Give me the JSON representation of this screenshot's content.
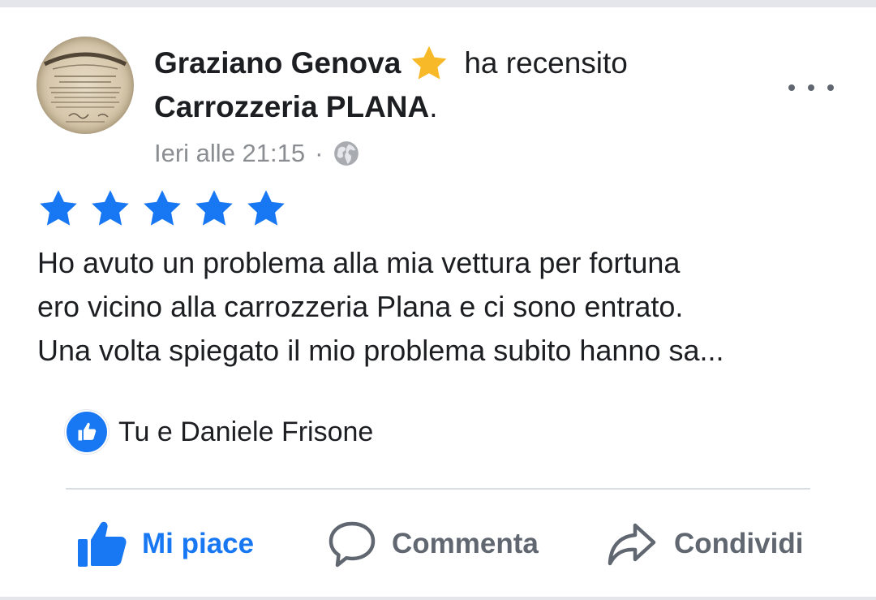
{
  "colors": {
    "facebook_blue": "#1877f2",
    "badge_gold": "#f7b928",
    "text_primary": "#1c1e21",
    "text_secondary": "#8a8d91",
    "icon_gray": "#606770"
  },
  "post": {
    "author": "Graziano Genova",
    "author_badge_icon": "star-icon",
    "action_text": "ha recensito",
    "page_name": "Carrozzeria PLANA",
    "page_suffix": ".",
    "timestamp": "Ieri alle 21:15",
    "meta_separator": "·",
    "privacy_icon": "globe-icon",
    "more_icon": "more-options-icon"
  },
  "review": {
    "rating": 5,
    "rating_max": 5,
    "text_lines": [
      "Ho avuto un problema alla mia vettura per fortuna",
      "ero vicino alla carrozzeria Plana e ci sono entrato.",
      "Una volta spiegato il mio problema subito hanno sa..."
    ]
  },
  "reactions": {
    "icon": "like-icon",
    "text": "Tu e Daniele Frisone"
  },
  "actions": {
    "like": {
      "label": "Mi piace",
      "icon": "thumbs-up-icon"
    },
    "comment": {
      "label": "Commenta",
      "icon": "comment-icon"
    },
    "share": {
      "label": "Condividi",
      "icon": "share-icon"
    }
  }
}
